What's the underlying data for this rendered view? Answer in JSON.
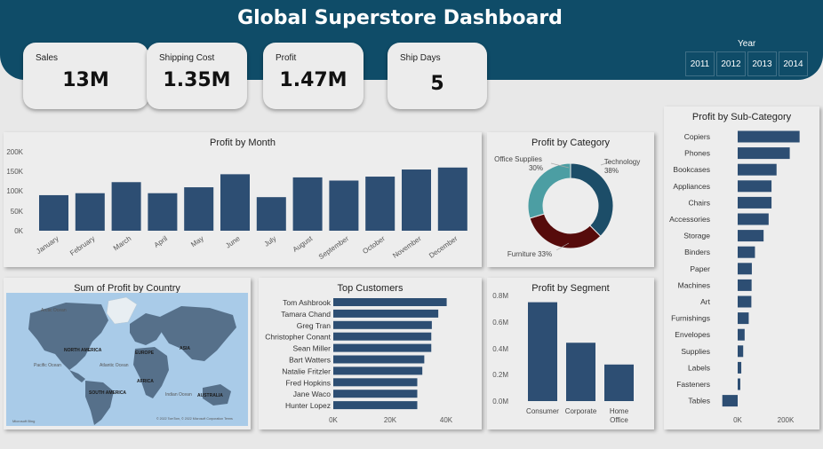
{
  "header": {
    "title": "Global Superstore Dashboard"
  },
  "kpis": {
    "sales": {
      "label": "Sales",
      "value": "13M"
    },
    "shipping": {
      "label": "Shipping Cost",
      "value": "1.35M"
    },
    "profit": {
      "label": "Profit",
      "value": "1.47M"
    },
    "ship_days": {
      "label": "Ship Days",
      "value": "5"
    }
  },
  "year_filter": {
    "label": "Year",
    "options": [
      "2011",
      "2012",
      "2013",
      "2014"
    ]
  },
  "colors": {
    "header": "#0f4c68",
    "bar": "#2d4e73",
    "technology": "#1c4d68",
    "office_supplies": "#4c9ea3",
    "furniture": "#560b0b"
  },
  "profit_by_month": {
    "title": "Profit by Month",
    "y_ticks": [
      "200K",
      "150K",
      "100K",
      "50K",
      "0K"
    ],
    "chart_data": {
      "type": "bar",
      "categories": [
        "January",
        "February",
        "March",
        "April",
        "May",
        "June",
        "July",
        "August",
        "September",
        "October",
        "November",
        "December"
      ],
      "values": [
        90000,
        95000,
        123000,
        95000,
        110000,
        143000,
        85000,
        135000,
        127000,
        137000,
        155000,
        160000
      ],
      "ylim": [
        0,
        200000
      ]
    }
  },
  "profit_by_category": {
    "title": "Profit by Category",
    "labels": {
      "office": "Office Supplies",
      "office_pct": "30%",
      "tech": "Technology",
      "tech_pct": "38%",
      "furniture": "Furniture 33%"
    },
    "chart_data": {
      "type": "pie",
      "categories": [
        "Technology",
        "Furniture",
        "Office Supplies"
      ],
      "values": [
        38,
        33,
        30
      ]
    }
  },
  "profit_by_subcategory": {
    "title": "Profit by Sub-Category",
    "x_ticks": [
      "0K",
      "200K"
    ],
    "chart_data": {
      "type": "bar",
      "categories": [
        "Copiers",
        "Phones",
        "Bookcases",
        "Appliances",
        "Chairs",
        "Accessories",
        "Storage",
        "Binders",
        "Paper",
        "Machines",
        "Art",
        "Furnishings",
        "Envelopes",
        "Supplies",
        "Labels",
        "Fasteners",
        "Tables"
      ],
      "values": [
        258000,
        217000,
        162000,
        141000,
        141000,
        129000,
        108000,
        72000,
        59000,
        58000,
        57000,
        46000,
        29000,
        23000,
        15000,
        11000,
        -64000
      ],
      "xlim": [
        -80000,
        300000
      ]
    }
  },
  "profit_by_country": {
    "title": "Sum of Profit by Country",
    "labels": {
      "arctic": "Arctic Ocean",
      "north_america": "NORTH AMERICA",
      "europe": "EUROPE",
      "asia": "ASIA",
      "africa": "AFRICA",
      "south_america": "SOUTH AMERICA",
      "australia": "AUSTRALIA",
      "pacific": "Pacific Ocean",
      "atlantic": "Atlantic Ocean",
      "indian": "Indian Ocean",
      "attribution": "© 2022 TomTom, © 2022 Microsoft Corporation  Terms",
      "brand": "Microsoft Bing"
    }
  },
  "top_customers": {
    "title": "Top Customers",
    "x_ticks": [
      "0K",
      "20K",
      "40K"
    ],
    "chart_data": {
      "type": "bar",
      "categories": [
        "Tom Ashbrook",
        "Tamara Chand",
        "Greg Tran",
        "Christopher Conant",
        "Sean Miller",
        "Bart Watters",
        "Natalie Fritzler",
        "Fred Hopkins",
        "Jane Waco",
        "Hunter Lopez"
      ],
      "values": [
        40500,
        37500,
        35200,
        35000,
        35000,
        32500,
        31800,
        30000,
        30000,
        30000
      ],
      "xlim": [
        0,
        50000
      ]
    }
  },
  "profit_by_segment": {
    "title": "Profit by Segment",
    "y_ticks": [
      "0.8M",
      "0.6M",
      "0.4M",
      "0.2M",
      "0.0M"
    ],
    "chart_data": {
      "type": "bar",
      "categories": [
        "Consumer",
        "Corporate",
        "Home Office"
      ],
      "values": [
        749000,
        442000,
        277000
      ],
      "ylim": [
        0,
        800000
      ]
    }
  }
}
